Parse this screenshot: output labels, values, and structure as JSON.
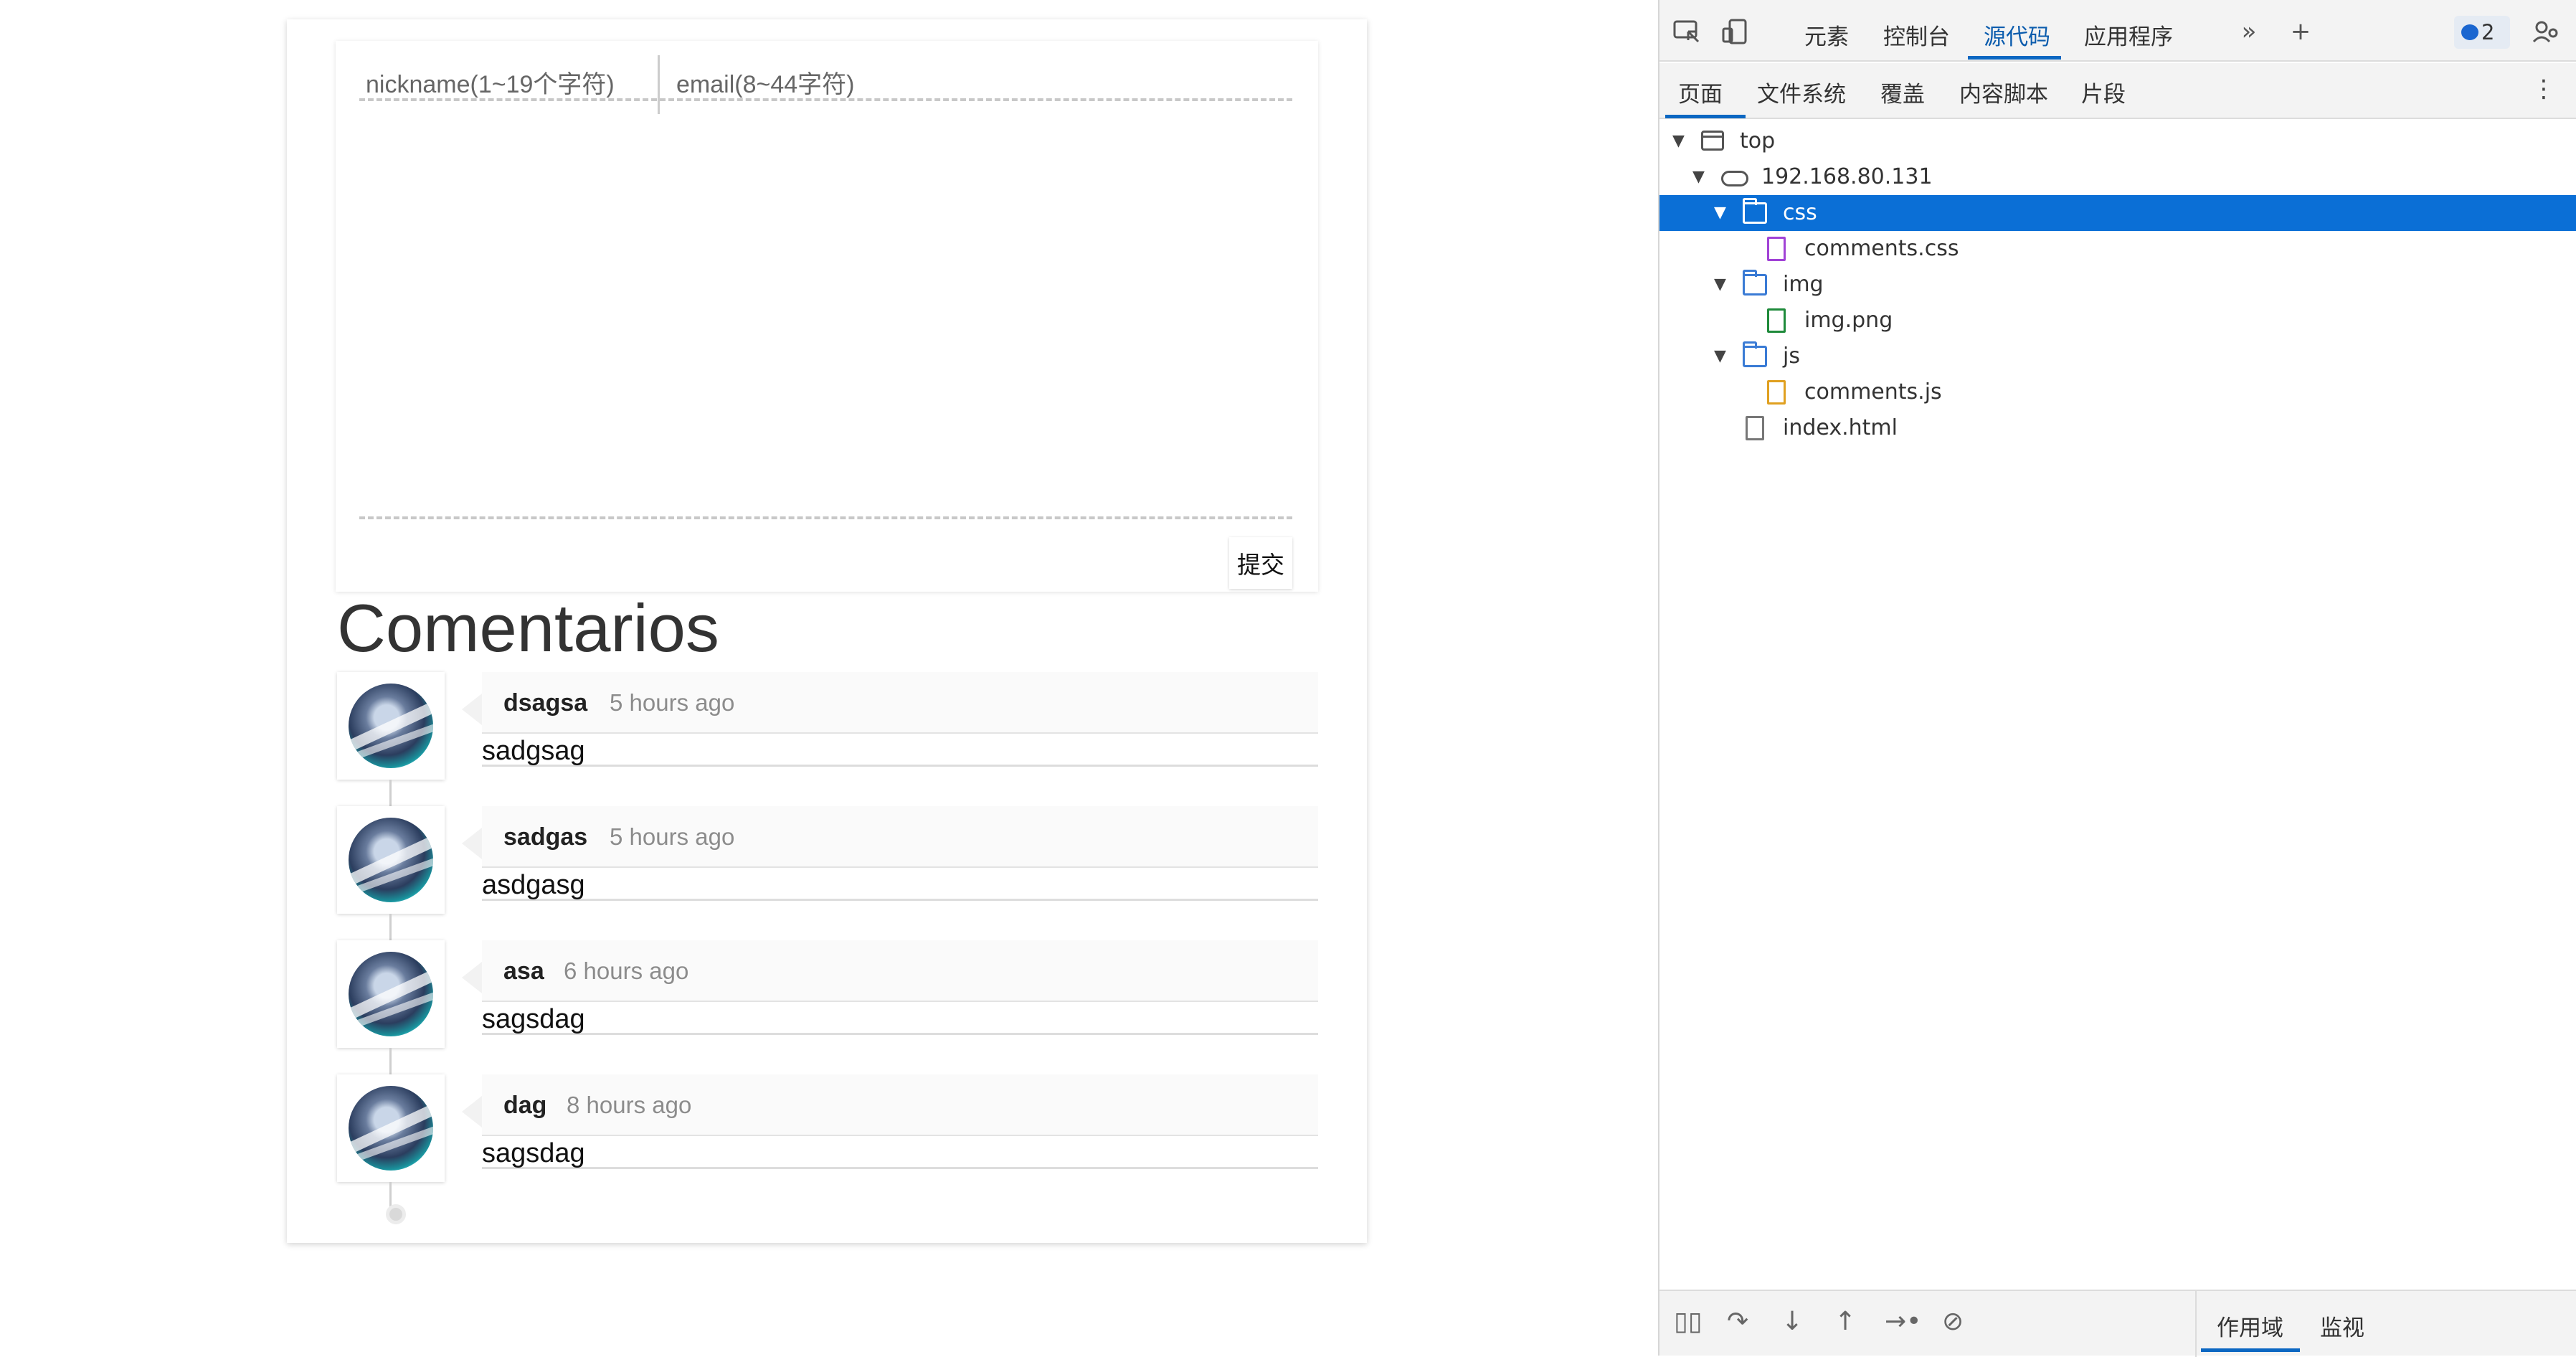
{
  "form": {
    "nickname_placeholder": "nickname(1~19个字符)",
    "email_placeholder": "email(8~44字符)",
    "submit_label": "提交"
  },
  "comments_title": "Comentarios",
  "comments": [
    {
      "name": "dsagsa",
      "time": "5 hours ago",
      "text": "sadgsag"
    },
    {
      "name": "sadgas",
      "time": "5 hours ago",
      "text": "asdgasg"
    },
    {
      "name": "asa",
      "time": "6 hours ago",
      "text": "sagsdag"
    },
    {
      "name": "dag",
      "time": "8 hours ago",
      "text": "sagsdag"
    }
  ],
  "devtools": {
    "tabs": [
      "元素",
      "控制台",
      "源代码",
      "应用程序"
    ],
    "active_tab": "源代码",
    "issues_count": "2",
    "sub_tabs": [
      "页面",
      "文件系统",
      "覆盖",
      "内容脚本",
      "片段"
    ],
    "active_sub_tab": "页面",
    "tree": [
      {
        "label": "top",
        "icon": "frame-icon"
      },
      {
        "label": "192.168.80.131",
        "icon": "cloud-icon"
      },
      {
        "label": "css",
        "icon": "folder-icon",
        "selected": true
      },
      {
        "label": "comments.css",
        "icon": "css-file-icon"
      },
      {
        "label": "img",
        "icon": "folder-icon"
      },
      {
        "label": "img.png",
        "icon": "image-file-icon"
      },
      {
        "label": "js",
        "icon": "folder-icon"
      },
      {
        "label": "comments.js",
        "icon": "js-file-icon"
      },
      {
        "label": "index.html",
        "icon": "html-file-icon"
      }
    ],
    "bottom_tabs": [
      "作用域",
      "监视"
    ],
    "active_bottom_tab": "作用域"
  },
  "colors": {
    "accent": "#0b67c2",
    "selection": "#0b6fd6"
  }
}
